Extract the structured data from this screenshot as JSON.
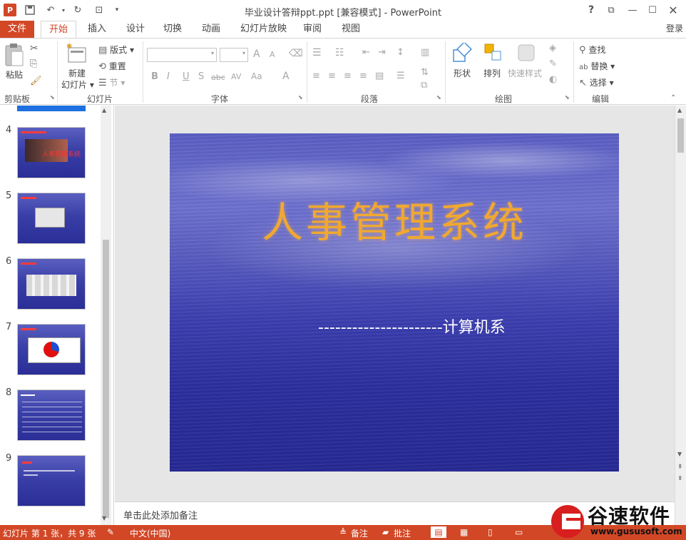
{
  "window": {
    "app_badge": "P",
    "title": "毕业设计答辩ppt.ppt [兼容模式] - PowerPoint",
    "help": "?",
    "login": "登录"
  },
  "tabs": [
    "文件",
    "开始",
    "插入",
    "设计",
    "切换",
    "动画",
    "幻灯片放映",
    "审阅",
    "视图"
  ],
  "ribbon": {
    "clipboard": {
      "paste": "粘贴",
      "label": "剪贴板"
    },
    "slides": {
      "new_slide_1": "新建",
      "new_slide_2": "幻灯片",
      "layout": "版式",
      "reset": "重置",
      "section": "节",
      "label": "幻灯片"
    },
    "font": {
      "label": "字体",
      "bold": "B",
      "italic": "I",
      "underline": "U",
      "shadow": "S",
      "strike": "abc",
      "spacing": "AV",
      "case": "Aa",
      "color": "A",
      "grow": "A",
      "shrink": "A"
    },
    "paragraph": {
      "label": "段落"
    },
    "drawing": {
      "shapes": "形状",
      "arrange": "排列",
      "quick_styles": "快速样式",
      "label": "绘图"
    },
    "editing": {
      "find": "查找",
      "replace": "替换",
      "select": "选择",
      "label": "编辑"
    }
  },
  "slide_thumbnails": [
    {
      "num": "4",
      "caption": "人事管理系统"
    },
    {
      "num": "5",
      "caption": ""
    },
    {
      "num": "6",
      "caption": ""
    },
    {
      "num": "7",
      "caption": ""
    },
    {
      "num": "8",
      "caption": ""
    },
    {
      "num": "9",
      "caption": ""
    }
  ],
  "slide": {
    "title": "人事管理系统",
    "subtitle": "----------------------计算机系"
  },
  "notes_placeholder": "单击此处添加备注",
  "status": {
    "slide_info": "幻灯片 第 1 张，共 9 张",
    "language": "中文(中国)",
    "notes": "备注",
    "comments": "批注"
  },
  "watermark": {
    "brand": "谷速软件",
    "url": "www.gususoft.com"
  },
  "colors": {
    "accent": "#d24726",
    "slide_blue": "#3c3fb0",
    "title_orange": "#f0a830"
  }
}
